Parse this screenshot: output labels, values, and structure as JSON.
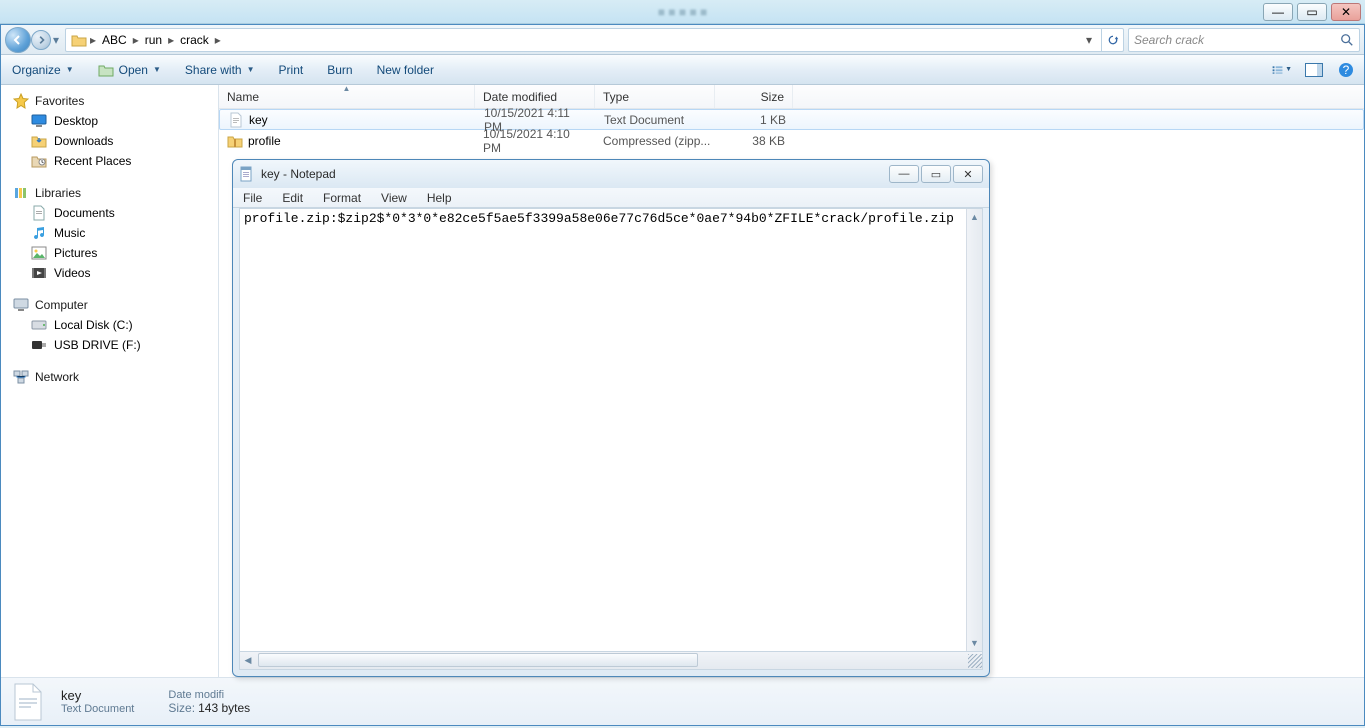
{
  "window_controls": {
    "min": "—",
    "max": "▭",
    "close": "✕"
  },
  "breadcrumb": {
    "parts": [
      "ABC",
      "run",
      "crack"
    ],
    "recent_drop": "▾",
    "refresh": "↻"
  },
  "search": {
    "placeholder": "Search crack"
  },
  "toolbar": {
    "organize": "Organize",
    "open": "Open",
    "share": "Share with",
    "print": "Print",
    "burn": "Burn",
    "newfolder": "New folder"
  },
  "sidebar": {
    "favorites": {
      "label": "Favorites",
      "items": [
        "Desktop",
        "Downloads",
        "Recent Places"
      ]
    },
    "libraries": {
      "label": "Libraries",
      "items": [
        "Documents",
        "Music",
        "Pictures",
        "Videos"
      ]
    },
    "computer": {
      "label": "Computer",
      "items": [
        "Local Disk (C:)",
        "USB DRIVE (F:)"
      ]
    },
    "network": {
      "label": "Network"
    }
  },
  "columns": {
    "name": "Name",
    "date": "Date modified",
    "type": "Type",
    "size": "Size"
  },
  "files": [
    {
      "name": "key",
      "date": "10/15/2021 4:11 PM",
      "type": "Text Document",
      "size": "1 KB",
      "icon": "txt",
      "selected": true
    },
    {
      "name": "profile",
      "date": "10/15/2021 4:10 PM",
      "type": "Compressed (zipp...",
      "size": "38 KB",
      "icon": "zip",
      "selected": false
    }
  ],
  "details": {
    "name": "key",
    "type": "Text Document",
    "date_lbl": "Date modifi",
    "size_lbl": "Size:",
    "size_val": "143 bytes"
  },
  "notepad": {
    "title": "key - Notepad",
    "menus": [
      "File",
      "Edit",
      "Format",
      "View",
      "Help"
    ],
    "content": "profile.zip:$zip2$*0*3*0*e82ce5f5ae5f3399a58e06e77c76d5ce*0ae7*94b0*ZFILE*crack/profile.zip"
  }
}
